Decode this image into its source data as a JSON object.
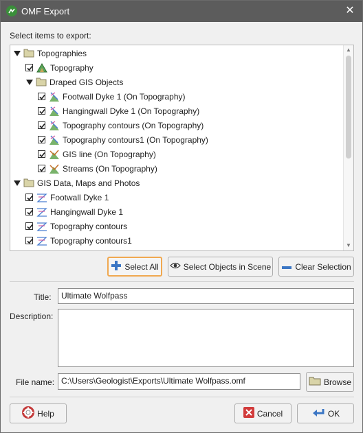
{
  "window": {
    "title": "OMF Export",
    "close_glyph": "✕"
  },
  "select_label": "Select items to export:",
  "tree": [
    {
      "label": "Topographies",
      "type": "folder",
      "checkbox": false,
      "expanded": true,
      "icon": "folder-icon"
    },
    {
      "label": "Topography",
      "type": "item",
      "checkbox": true,
      "checked": true,
      "icon": "topography-icon"
    },
    {
      "label": "Draped GIS Objects",
      "type": "folder",
      "checkbox": false,
      "expanded": true,
      "icon": "folder-icon"
    },
    {
      "label": "Footwall Dyke 1 (On Topography)",
      "type": "item",
      "checkbox": true,
      "checked": true,
      "icon": "draped-gis-icon"
    },
    {
      "label": "Hangingwall Dyke 1 (On Topography)",
      "type": "item",
      "checkbox": true,
      "checked": true,
      "icon": "draped-gis-icon"
    },
    {
      "label": "Topography contours (On Topography)",
      "type": "item",
      "checkbox": true,
      "checked": true,
      "icon": "draped-gis-icon"
    },
    {
      "label": "Topography contours1 (On Topography)",
      "type": "item",
      "checkbox": true,
      "checked": true,
      "icon": "draped-gis-icon"
    },
    {
      "label": "GIS line (On Topography)",
      "type": "item",
      "checkbox": true,
      "checked": true,
      "icon": "gis-line-icon"
    },
    {
      "label": "Streams (On Topography)",
      "type": "item",
      "checkbox": true,
      "checked": true,
      "icon": "gis-line-icon"
    },
    {
      "label": "GIS Data, Maps and Photos",
      "type": "folder",
      "checkbox": false,
      "expanded": true,
      "icon": "folder-icon"
    },
    {
      "label": "Footwall Dyke 1",
      "type": "item",
      "checkbox": true,
      "checked": true,
      "icon": "gis-data-icon"
    },
    {
      "label": "Hangingwall Dyke 1",
      "type": "item",
      "checkbox": true,
      "checked": true,
      "icon": "gis-data-icon"
    },
    {
      "label": "Topography contours",
      "type": "item",
      "checkbox": true,
      "checked": true,
      "icon": "gis-data-icon"
    },
    {
      "label": "Topography contours1",
      "type": "item",
      "checkbox": true,
      "checked": true,
      "icon": "gis-data-icon"
    }
  ],
  "buttons": {
    "select_all": "Select All",
    "select_objects": "Select Objects in Scene",
    "clear_selection": "Clear Selection",
    "browse": "Browse",
    "help": "Help",
    "cancel": "Cancel",
    "ok": "OK"
  },
  "fields": {
    "title_label": "Title:",
    "title_value": "Ultimate Wolfpass",
    "description_label": "Description:",
    "description_value": "",
    "file_label": "File name:",
    "file_value": "C:\\Users\\Geologist\\Exports\\Ultimate Wolfpass.omf"
  },
  "colors": {
    "titlebar": "#5c5c5c",
    "accent": "#f0a850",
    "folder": "#d9d4a8"
  }
}
